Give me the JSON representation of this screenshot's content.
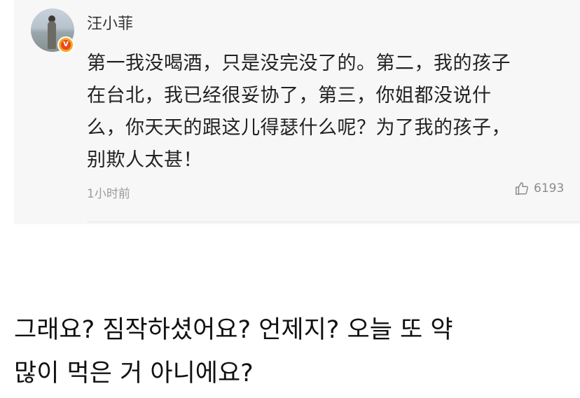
{
  "comment": {
    "username": "汪小菲",
    "verified_badge": "V",
    "text": "第一我没喝酒，只是没完没了的。第二，我的孩子\n在台北，我已经很妥协了，第三，你姐都没说什\n么，你天天的跟这儿得瑟什么呢？为了我的孩子，\n别欺人太甚！",
    "timestamp": "1小时前",
    "like_count": "6193",
    "like_icon": "thumbs-up-icon"
  },
  "caption": {
    "text": "그래요? 짐작하셨어요? 언제지? 오늘 또 약\n많이 먹은 거 아니에요?"
  },
  "colors": {
    "card_background": "#f7f7f7",
    "verified_outer": "#f5a623",
    "verified_inner": "#e8481c"
  }
}
